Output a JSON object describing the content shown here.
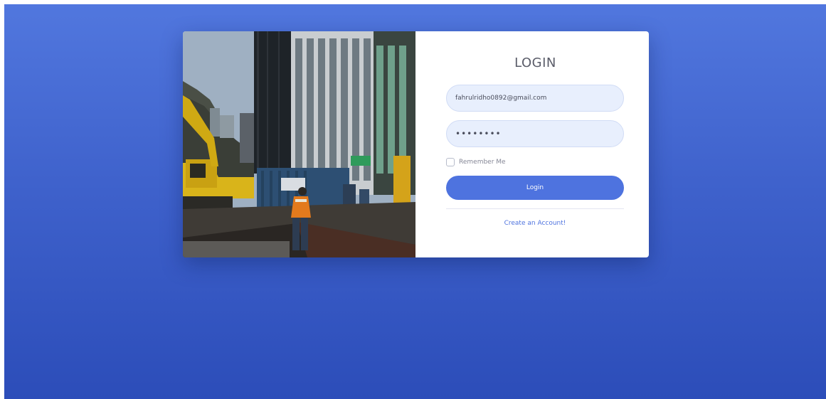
{
  "login": {
    "title": "LOGIN",
    "email_value": "fahrulridho0892@gmail.com",
    "password_value": "••••••••",
    "remember_label": "Remember Me",
    "submit_label": "Login",
    "create_account_label": "Create an Account!"
  },
  "colors": {
    "background_top": "#5177de",
    "background_bottom": "#2c4db9",
    "primary": "#4e73df",
    "input_background": "#e8effd"
  },
  "photo": {
    "subject": "construction site between high-rise buildings"
  }
}
